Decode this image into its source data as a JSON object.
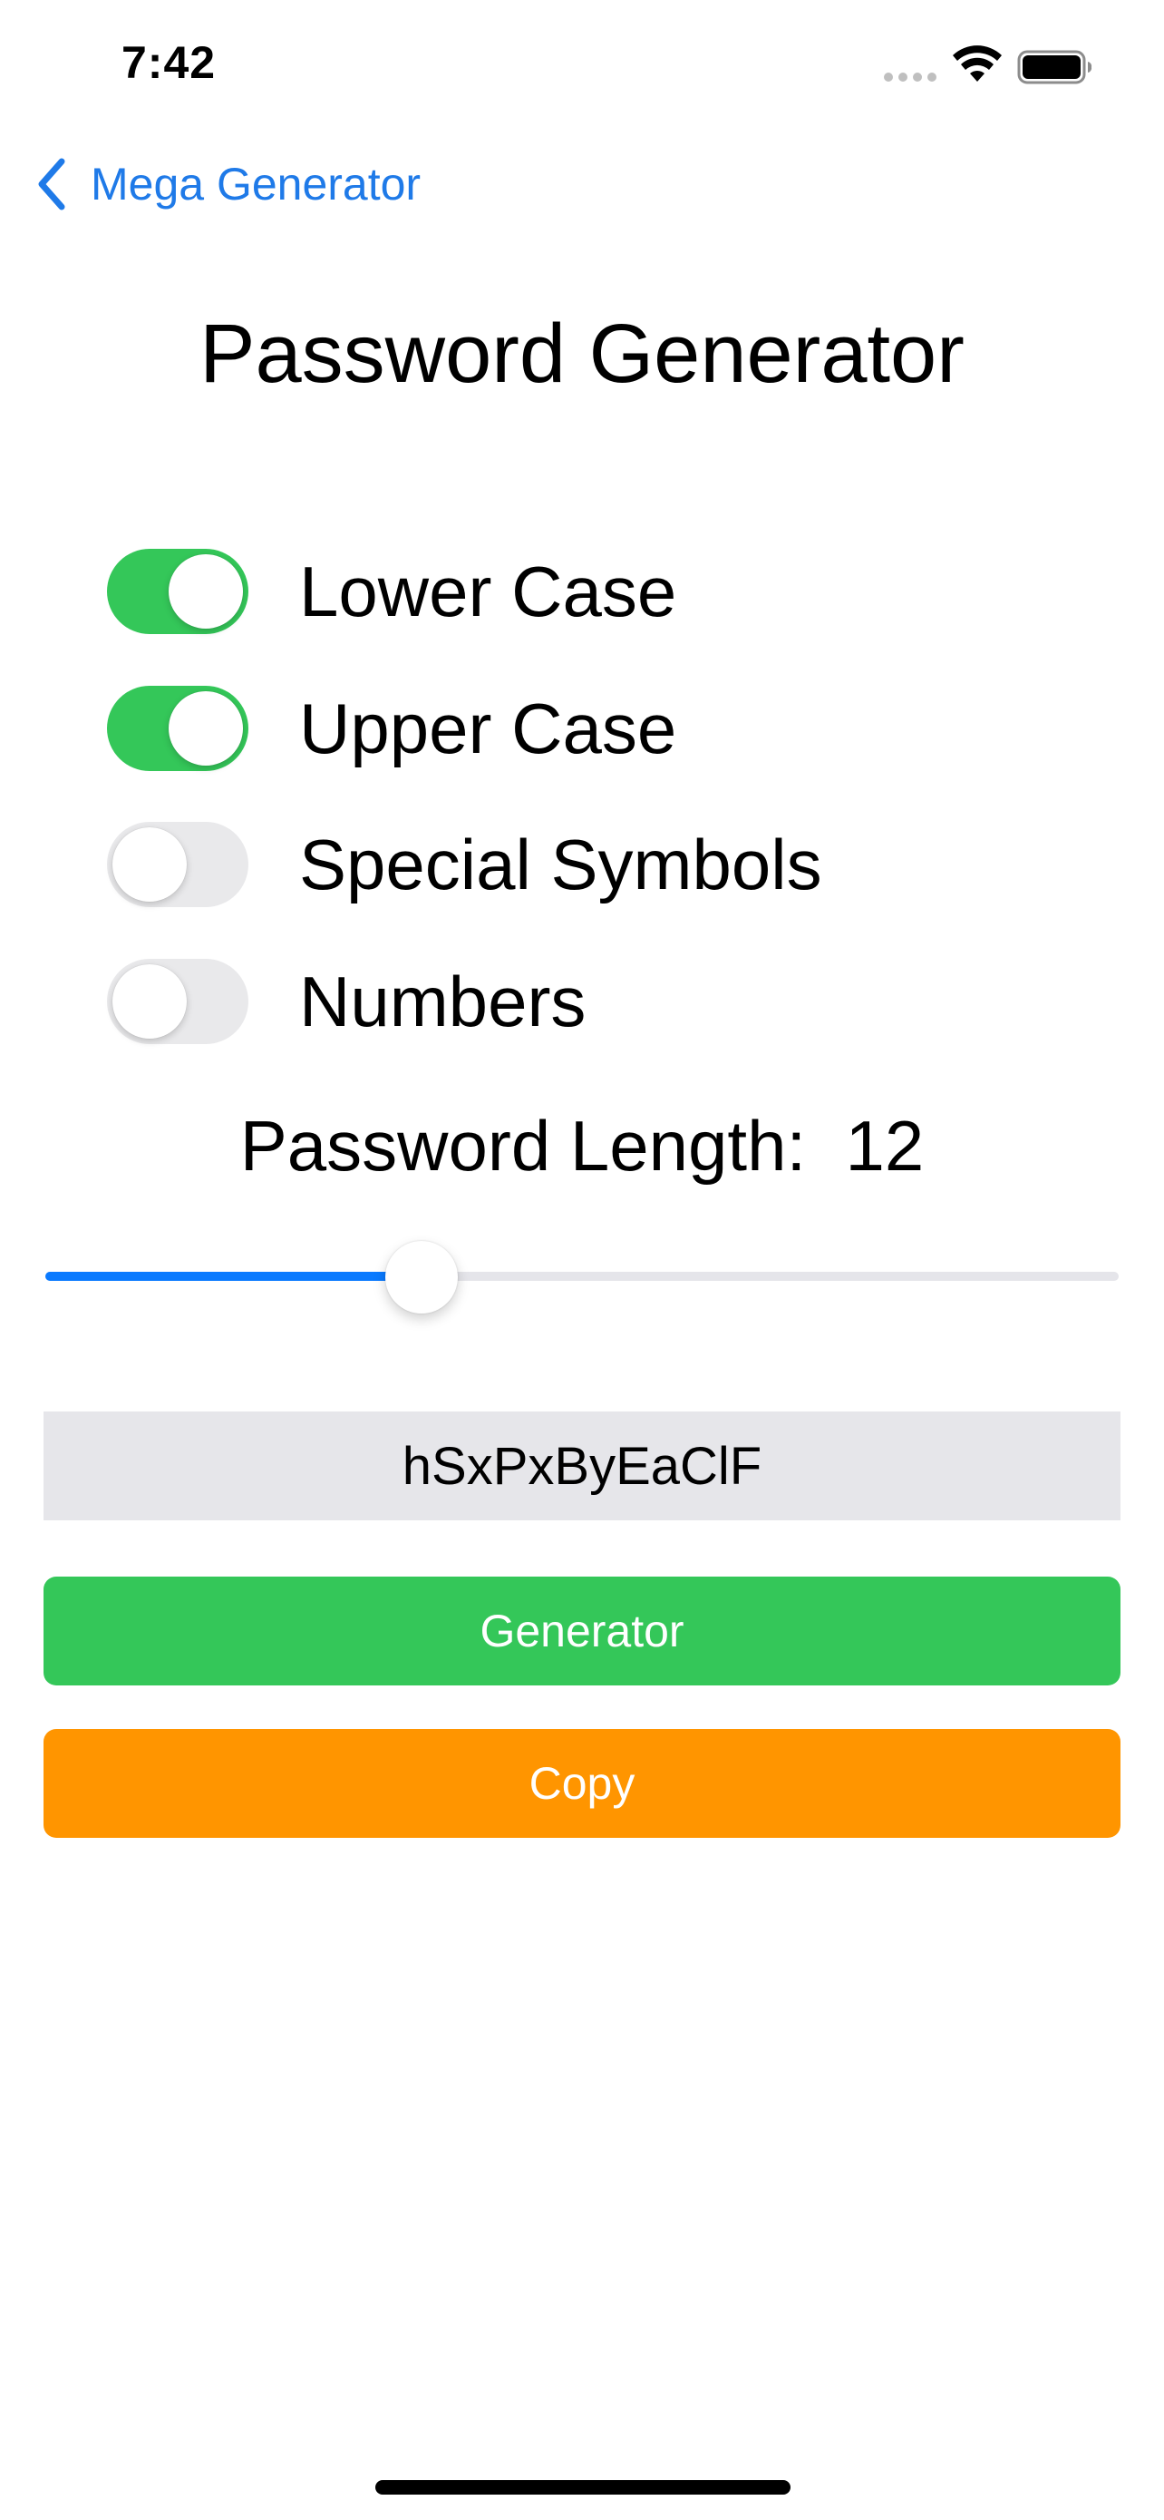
{
  "status_bar": {
    "time": "7:42"
  },
  "nav": {
    "back_label": "Mega Generator"
  },
  "title": "Password Generator",
  "options": [
    {
      "label": "Lower Case",
      "on": true
    },
    {
      "label": "Upper Case",
      "on": true
    },
    {
      "label": "Special Symbols",
      "on": false
    },
    {
      "label": "Numbers",
      "on": false
    }
  ],
  "length": {
    "label": "Password Length:  12",
    "slider_fraction": 0.34
  },
  "password": "hSxPxByEaClF",
  "buttons": {
    "generate_label": "Generator",
    "copy_label": "Copy"
  },
  "colors": {
    "accent_blue": "#1f7ae8",
    "toggle_on": "#34c759",
    "generate_button": "#34c759",
    "copy_button": "#ff9500",
    "field_background": "#e6e6ea"
  }
}
